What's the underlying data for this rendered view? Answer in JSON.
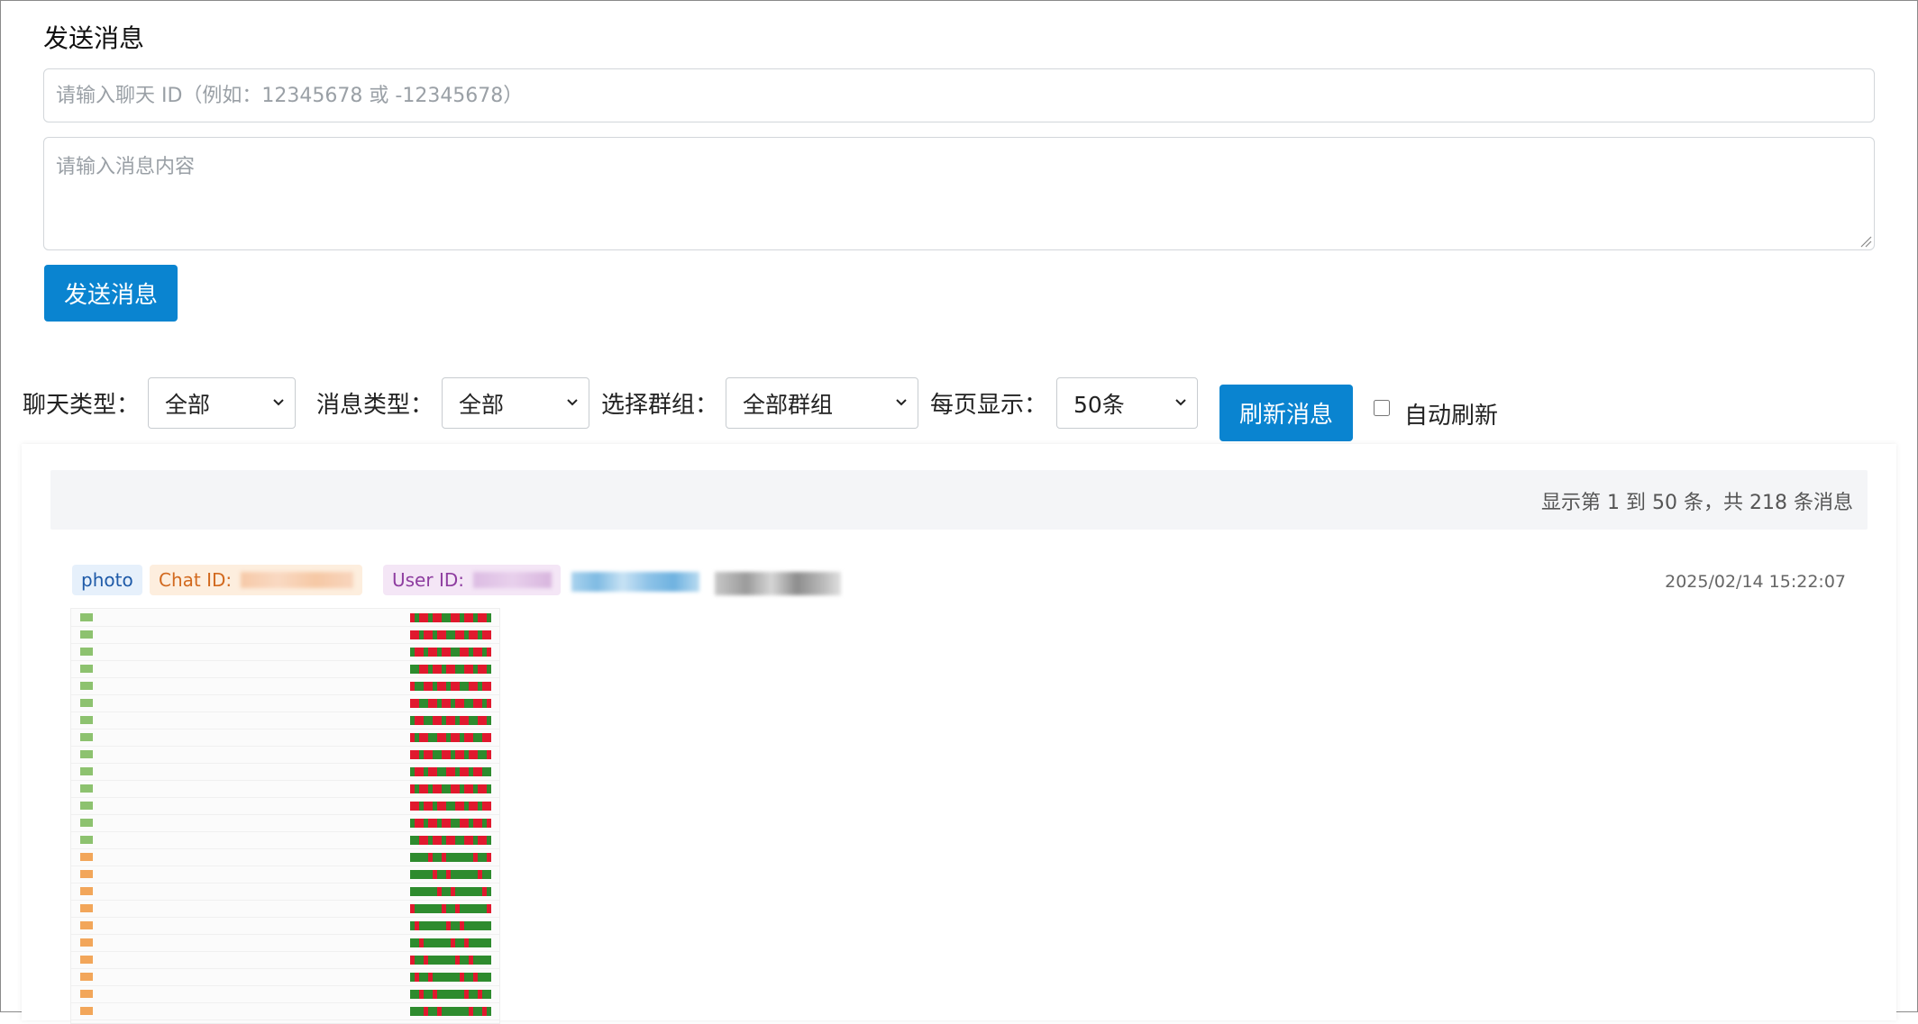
{
  "send_form": {
    "title": "发送消息",
    "chat_id_placeholder": "请输入聊天 ID（例如：12345678 或 -12345678）",
    "message_placeholder": "请输入消息内容",
    "send_button": "发送消息"
  },
  "filters": {
    "chat_type": {
      "label": "聊天类型：",
      "value": "全部"
    },
    "message_type": {
      "label": "消息类型：",
      "value": "全部"
    },
    "group": {
      "label": "选择群组：",
      "value": "全部群组"
    },
    "page_size": {
      "label": "每页显示：",
      "value": "50条"
    },
    "refresh_button": "刷新消息",
    "auto_refresh": {
      "label": "自动刷新",
      "checked": false
    }
  },
  "summary": "显示第 1 到 50 条，共 218 条消息",
  "messages": [
    {
      "type": "photo",
      "chat_id_label": "Chat ID:",
      "user_id_label": "User ID:",
      "timestamp": "2025/02/14 15:22:07"
    }
  ],
  "colors": {
    "primary": "#0a84d0",
    "tag_photo_bg": "#e6f0fb",
    "tag_chat_bg": "#fdeede",
    "tag_user_bg": "#f4e6f6"
  }
}
